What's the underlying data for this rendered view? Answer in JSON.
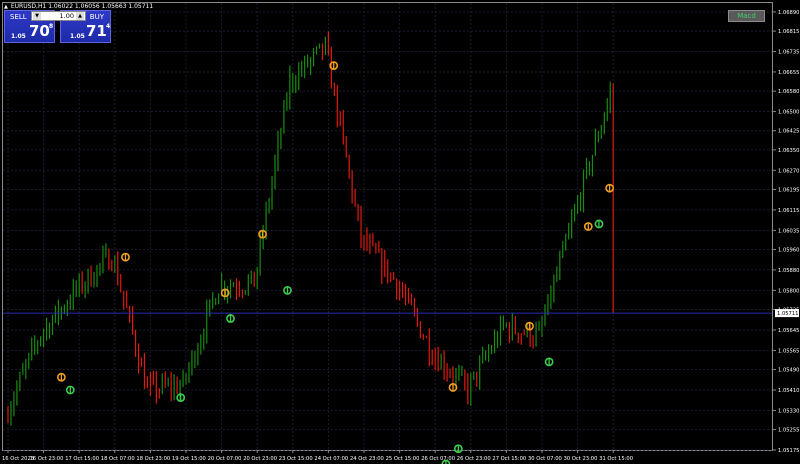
{
  "header": {
    "symbol": "EURUSD,H1",
    "ohlc": "1.06022 1.06056 1.05663 1.05711"
  },
  "trade_panel": {
    "sell_label": "SELL",
    "buy_label": "BUY",
    "lot": "1.00",
    "sell_price_prefix": "1.05",
    "sell_price_big": "70",
    "sell_price_sup": "8",
    "buy_price_prefix": "1.05",
    "buy_price_big": "71",
    "buy_price_sup": "4"
  },
  "macd_button": "Macd",
  "current_price": "1.05711",
  "price_axis": {
    "ticks": [
      "1.06890",
      "1.06815",
      "1.06735",
      "1.06655",
      "1.06580",
      "1.06500",
      "1.06425",
      "1.06350",
      "1.06270",
      "1.06195",
      "1.06115",
      "1.06035",
      "1.05960",
      "1.05880",
      "1.05800",
      "1.05725",
      "1.05645",
      "1.05565",
      "1.05490",
      "1.05410",
      "1.05330",
      "1.05255",
      "1.05175"
    ]
  },
  "time_axis": {
    "ticks": [
      "16 Oct 2023",
      "16 Oct 23:00",
      "17 Oct 15:00",
      "18 Oct 07:00",
      "18 Oct 23:00",
      "19 Oct 15:00",
      "20 Oct 07:00",
      "20 Oct 23:00",
      "23 Oct 15:00",
      "24 Oct 07:00",
      "24 Oct 23:00",
      "25 Oct 15:00",
      "26 Oct 07:00",
      "26 Oct 23:00",
      "27 Oct 15:00",
      "30 Oct 07:00",
      "30 Oct 23:00",
      "31 Oct 15:00"
    ]
  },
  "colors": {
    "background": "#000000",
    "bull_bar": "#1a8c12",
    "bear_bar": "#e01a10",
    "up_arrow": "#3cd050",
    "down_arrow": "#f0a020",
    "bid_line": "#2a2aa8",
    "grid": "#1b1b30"
  },
  "chart_data": {
    "type": "line",
    "title": "EURUSD,H1",
    "x": [
      "16 Oct 2023",
      "16 Oct 23:00",
      "17 Oct 15:00",
      "18 Oct 07:00",
      "18 Oct 23:00",
      "19 Oct 15:00",
      "20 Oct 07:00",
      "20 Oct 23:00",
      "23 Oct 15:00",
      "24 Oct 07:00",
      "24 Oct 23:00",
      "25 Oct 15:00",
      "26 Oct 07:00",
      "26 Oct 23:00",
      "27 Oct 15:00",
      "30 Oct 07:00",
      "30 Oct 23:00",
      "31 Oct 15:00"
    ],
    "y": [
      1.0531,
      1.0563,
      1.058,
      1.0594,
      1.0541,
      1.0543,
      1.0582,
      1.0583,
      1.0662,
      1.0675,
      1.06,
      1.0583,
      1.0556,
      1.0541,
      1.0566,
      1.0562,
      1.061,
      1.0657
    ],
    "close": 1.05711,
    "ylim": [
      1.05175,
      1.06925
    ],
    "grid": true,
    "ylabel": "",
    "xlabel": ""
  }
}
